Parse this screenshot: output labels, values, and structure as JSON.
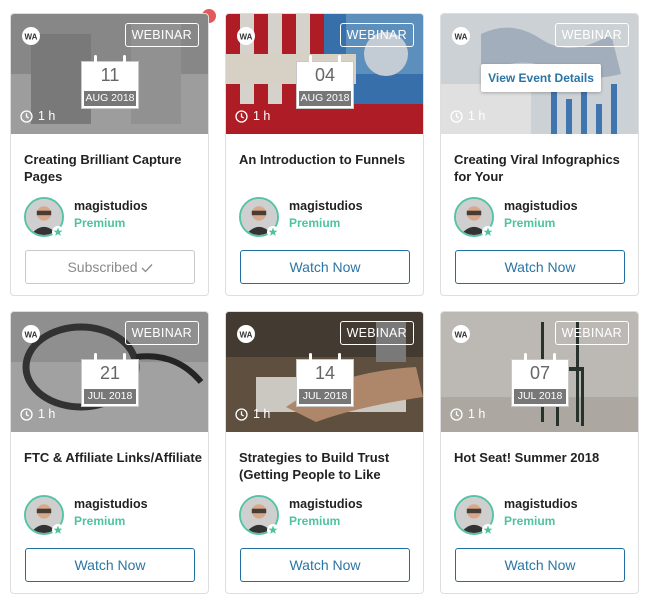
{
  "badge_label": "WEBINAR",
  "duration": "1 h",
  "author": "magistudios",
  "tier": "Premium",
  "accent_color": "#4fc2a0",
  "button_color": "#2a75a5",
  "notification_color": "#e25a5a",
  "cards": [
    {
      "title": "Creating Brilliant Capture Pages",
      "day": "11",
      "month": "AUG 2018",
      "button": "Subscribed",
      "button_state": "subscribed"
    },
    {
      "title": "An Introduction to Funnels",
      "day": "04",
      "month": "AUG 2018",
      "button": "Watch Now",
      "button_state": "default"
    },
    {
      "title": "Creating Viral Infographics for Your",
      "day": "",
      "month": "",
      "button": "Watch Now",
      "button_state": "default",
      "hover_action": "View Event Details"
    },
    {
      "title": "FTC & Affiliate Links/Affiliate",
      "day": "21",
      "month": "JUL 2018",
      "button": "Watch Now",
      "button_state": "default"
    },
    {
      "title": "Strategies to Build Trust (Getting People to Like",
      "day": "14",
      "month": "JUL 2018",
      "button": "Watch Now",
      "button_state": "default"
    },
    {
      "title": "Hot Seat! Summer 2018",
      "day": "07",
      "month": "JUL 2018",
      "button": "Watch Now",
      "button_state": "default"
    }
  ]
}
